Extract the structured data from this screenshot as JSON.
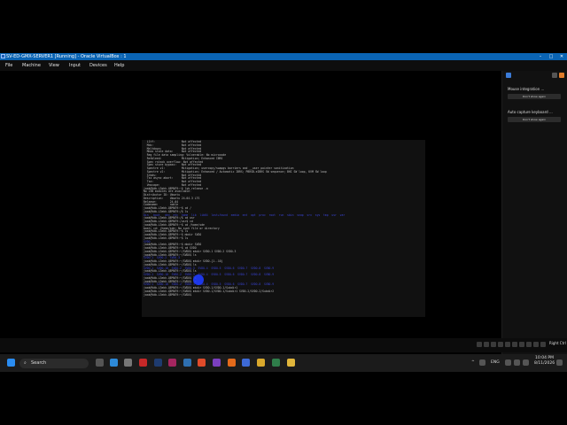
{
  "window": {
    "title": "SV-ED-GMX-SERVER1 [Running] - Oracle VirtualBox : 1",
    "minimize": "–",
    "maximize": "□",
    "close": "✕"
  },
  "menu": [
    "File",
    "Machine",
    "View",
    "Input",
    "Devices",
    "Help"
  ],
  "terminal": {
    "lines": [
      {
        "t": "  L1tf:                Not affected",
        "c": ""
      },
      {
        "t": "  Mds:                 Not affected",
        "c": ""
      },
      {
        "t": "  Meltdown:            Not affected",
        "c": ""
      },
      {
        "t": "  Mmio stale data:     Not affected",
        "c": ""
      },
      {
        "t": "  Reg file data sampling: Vulnerable: No microcode",
        "c": ""
      },
      {
        "t": "  Retbleed:            Mitigation; Enhanced IBRS",
        "c": ""
      },
      {
        "t": "  Spec rstack overflow: Not affected",
        "c": ""
      },
      {
        "t": "  Spec store bypass:   Not affected",
        "c": ""
      },
      {
        "t": "  Spectre v1:          Mitigation; usercopy/swapgs barriers and __user pointer sanitization",
        "c": ""
      },
      {
        "t": "  Spectre v2:          Mitigation; Enhanced / Automatic IBRS; PBRSB-eIBRS SW sequence; BHI SW loop, KVM SW loop",
        "c": ""
      },
      {
        "t": "  Srbds:               Not affected",
        "c": ""
      },
      {
        "t": "  Tsx async abort:     Not affected",
        "c": ""
      },
      {
        "t": "  Tsa:                 Not affected",
        "c": ""
      },
      {
        "t": "  Vmscape:             Not affected",
        "c": ""
      },
      {
        "t": "jaak@Vdb-L3ekh-QEMVE9:~$ lsb_release -a",
        "c": ""
      },
      {
        "t": "No LSB modules are available.",
        "c": ""
      },
      {
        "t": "Distributor ID: Ubuntu",
        "c": ""
      },
      {
        "t": "Description:    Ubuntu 24.04.3 LTS",
        "c": ""
      },
      {
        "t": "Release:        24.04",
        "c": ""
      },
      {
        "t": "Codename:       noble",
        "c": ""
      },
      {
        "t": "jaak@Vdb-L3ekh-QEMVE9:~$ cd /",
        "c": ""
      },
      {
        "t": "jaak@Vdb-L3ekh-QEMVE9:/$ ls",
        "c": ""
      },
      {
        "t": "bin   boot   dev  etc  home  lib  lib64  lost+found  media  mnt  opt  proc  root  run  sbin  snap  srv  sys  tmp  usr  var",
        "c": "blue"
      },
      {
        "t": "jaak@Vdb-L3ekh-QEMVE9:/$ cd usr",
        "c": ""
      },
      {
        "t": "jaak@Vdb-L3ekh-QEMVE9:/usr$ cd",
        "c": ""
      },
      {
        "t": "jaak@Vdb-L3ekh-QEMVE9:~$ cd /home/sde",
        "c": ""
      },
      {
        "t": "bash: cd: /home/sde: No such file or directory",
        "c": ""
      },
      {
        "t": "jaak@Vdb-L3ekh-QEMVE9:~$ ls",
        "c": ""
      },
      {
        "t": "jaak@Vdb-L3ekh-QEMVE9:~$ mkdir SVDO",
        "c": ""
      },
      {
        "t": "jaak@Vdb-L3ekh-QEMVE9:~$ ls",
        "c": ""
      },
      {
        "t": "SVDO",
        "c": "blue"
      },
      {
        "t": "jaak@Vdb-L3ekh-QEMVE9:~$ mkdir SVDO",
        "c": ""
      },
      {
        "t": "jaak@Vdb-L3ekh-QEMVE9:~$ cd SVDO",
        "c": ""
      },
      {
        "t": "jaak@Vdb-L3ekh-QEMVE9:~/SVDO$ mkdir SVDO-1 SVDO-2 SVDO-3",
        "c": ""
      },
      {
        "t": "jaak@Vdb-L3ekh-QEMVE9:~/SVDO$ ls",
        "c": ""
      },
      {
        "t": "SVDO-1  SVDO-2  SVDO-3",
        "c": "blue"
      },
      {
        "t": "jaak@Vdb-L3ekh-QEMVE9:~/SVDO$ mkdir SVDO-{1..10}",
        "c": ""
      },
      {
        "t": "jaak@Vdb-L3ekh-QEMVE9:~/SVDO$ ls",
        "c": ""
      },
      {
        "t": "SVDO-1  SVDO-10  SVDO-2  SVDO-3  SVDO-4  SVDO-5  SVDO-6  SVDO-7  SVDO-8  SVDO-9",
        "c": "blue"
      },
      {
        "t": "jaak@Vdb-L3ekh-QEMVE9:~/SVDO$ ls",
        "c": ""
      },
      {
        "t": "SVDO-1  SVDO-10  SVDO-2  SVDO-3  SVDO-4  SVDO-5  SVDO-6  SVDO-7  SVDO-8  SVDO-9",
        "c": "blue"
      },
      {
        "t": "jaak@Vdb-L3ekh-QEMVE9:~/SVDO$ ls",
        "c": ""
      },
      {
        "t": "jaak@Vdb-L3ekh-QEMVE9:~/SVDO$ ls",
        "c": ""
      },
      {
        "t": "SVDO-1  SVDO-10  SVDO-2  SVDO-3  SVDO-4  SVDO-5  SVDO-6  SVDO-7  SVDO-8  SVDO-9",
        "c": "blue"
      },
      {
        "t": "jaak@Vdb-L3ekh-QEMVE9:~/SVDO$ mkdir SVDO-1/SVDO-1/Subdir1",
        "c": ""
      },
      {
        "t": "jaak@Vdb-L3ekh-QEMVE9:~/SVDO$ mkdir SVDO-1/SVDO-1/Subdir1 SVDO-2/SVDO-2/Subdir2",
        "c": ""
      },
      {
        "t": "jaak@Vdb-L3ekh-QEMVE9:~/SVDO$ ",
        "c": ""
      }
    ]
  },
  "side_panel": {
    "mouse_integration": "Mouse integration ...",
    "mouse_btn": "Don't show again",
    "keyboard_capture": "Auto capture keyboard ...",
    "keyboard_btn": "Don't show again"
  },
  "status": {
    "right_ctrl": "Right Ctrl"
  },
  "taskbar": {
    "search_placeholder": "Search",
    "lang": "ENG",
    "time": "10:04 PM",
    "date": "8/11/2026"
  },
  "colors": {
    "titlebar": "#0a64b4",
    "terminal_bg": "#111111",
    "dir_blue": "#3a44d6"
  }
}
